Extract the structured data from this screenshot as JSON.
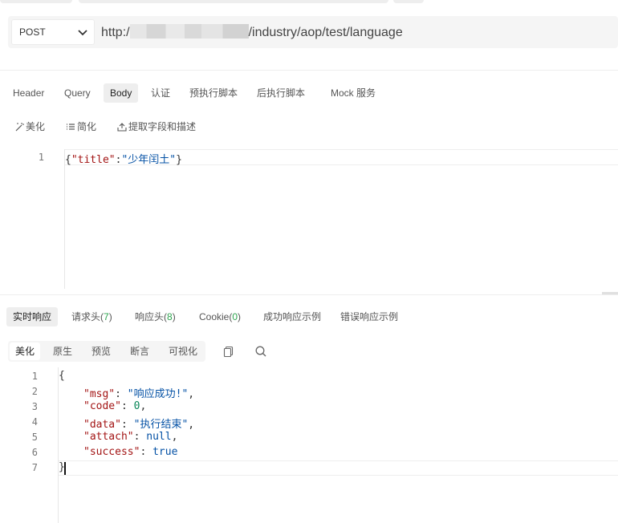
{
  "request": {
    "method": "POST",
    "url_prefix": "http:/",
    "url_suffix": "/industry/aop/test/language"
  },
  "request_tabs": [
    {
      "label": "Header"
    },
    {
      "label": "Query"
    },
    {
      "label": "Body"
    },
    {
      "label": "认证"
    },
    {
      "label": "预执行脚本"
    },
    {
      "label": "后执行脚本"
    },
    {
      "label": "Mock 服务"
    }
  ],
  "body_tools": {
    "beautify": "美化",
    "simplify": "简化",
    "extract": "提取字段和描述"
  },
  "request_body": {
    "line_numbers": [
      "1"
    ],
    "open": "{",
    "key": "\"title\"",
    "colon": ":",
    "value": "\"少年闰土\"",
    "close": "}"
  },
  "response_tabs": [
    {
      "label": "实时响应"
    },
    {
      "label": "请求头(",
      "count": "7",
      "suffix": ")"
    },
    {
      "label": "响应头(",
      "count": "8",
      "suffix": ")"
    },
    {
      "label": "Cookie(",
      "count": "0",
      "suffix": ")"
    },
    {
      "label": "成功响应示例"
    },
    {
      "label": "错误响应示例"
    }
  ],
  "view_modes": [
    {
      "label": "美化"
    },
    {
      "label": "原生"
    },
    {
      "label": "预览"
    },
    {
      "label": "断言"
    },
    {
      "label": "可视化"
    }
  ],
  "response_body": {
    "line_numbers": [
      "1",
      "2",
      "3",
      "4",
      "5",
      "6",
      "7"
    ],
    "open": "{",
    "close": "}",
    "fields": [
      {
        "key": "\"msg\"",
        "value": "\"响应成功!\"",
        "comma": ","
      },
      {
        "key": "\"code\"",
        "value": "0",
        "comma": ","
      },
      {
        "key": "\"data\"",
        "value": "\"执行结束\"",
        "comma": ","
      },
      {
        "key": "\"attach\"",
        "value": "null",
        "comma": ","
      },
      {
        "key": "\"success\"",
        "value": "true",
        "comma": ""
      }
    ]
  },
  "icons": {
    "chevron": "chevron-down-icon",
    "beautify": "magic-wand-icon",
    "simplify": "list-icon",
    "extract": "upload-icon",
    "copy": "copy-icon",
    "search": "search-icon"
  }
}
